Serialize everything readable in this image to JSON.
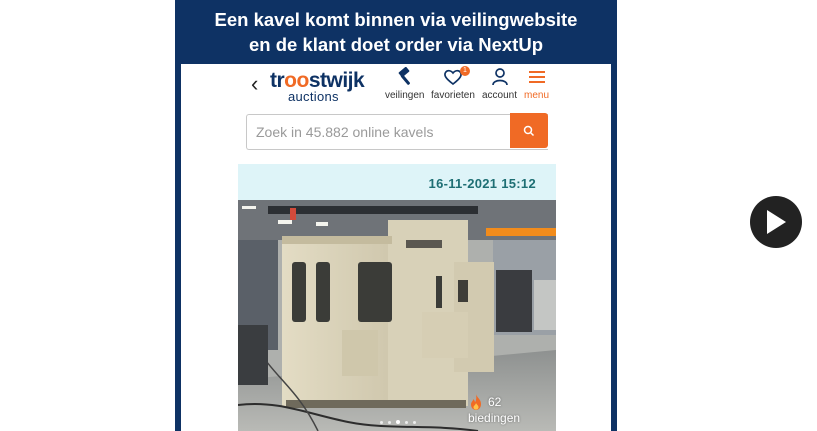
{
  "banner": {
    "line1": "Een kavel komt binnen via veilingwebsite",
    "line2": "en de klant doet order via NextUp"
  },
  "header": {
    "back_label": "‹",
    "logo": {
      "word_top": "troostwijk",
      "word_bottom": "auctions"
    },
    "nav": {
      "veilingen": {
        "label": "veilingen",
        "icon": "gavel-icon"
      },
      "favorieten": {
        "label": "favorieten",
        "icon": "heart-icon",
        "badge": "1"
      },
      "account": {
        "label": "account",
        "icon": "user-icon"
      },
      "menu": {
        "label": "menu",
        "icon": "hamburger-icon"
      }
    }
  },
  "search": {
    "placeholder": "Zoek in 45.882 online kavels",
    "button_icon": "search-icon"
  },
  "lot": {
    "date": "16-11-2021 15:12",
    "bids_count": "62",
    "bids_label": "biedingen",
    "carousel": {
      "total": 5,
      "active": 3
    }
  },
  "player": {
    "icon": "play-icon"
  },
  "colors": {
    "frame": "#0e3264",
    "accent": "#f06a25",
    "date_bar": "#def4f8",
    "date_text": "#1e6f74"
  }
}
